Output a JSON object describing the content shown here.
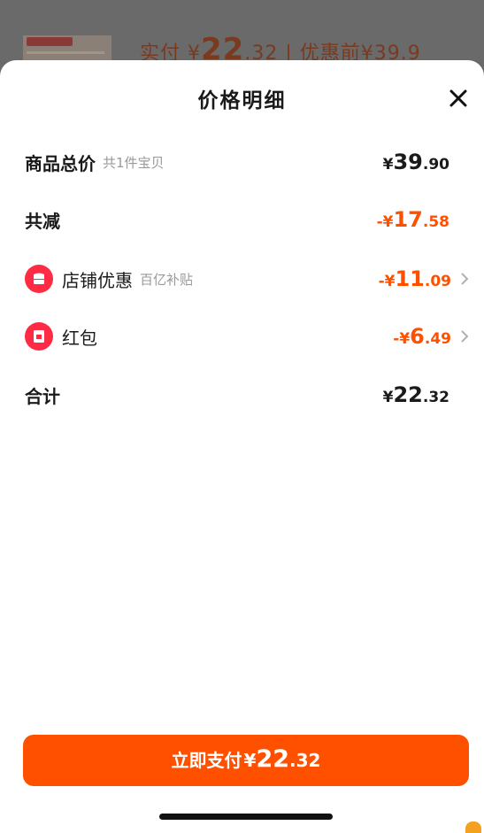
{
  "background": {
    "paid_label": "实付",
    "currency": "¥",
    "price_int": "22",
    "price_dec": ".32",
    "separator": "|",
    "original_label": "优惠前",
    "original_price": "¥39.9"
  },
  "sheet": {
    "title": "价格明细",
    "close_icon": "close-icon"
  },
  "rows": {
    "goods_total": {
      "label": "商品总价",
      "sub": "共1件宝贝",
      "currency": "¥",
      "int": "39",
      "dec": ".90"
    },
    "total_discount": {
      "label": "共减",
      "currency": "-¥",
      "int": "17",
      "dec": ".58"
    },
    "store_discount": {
      "icon": "store-coupon-icon",
      "label": "店铺优惠",
      "sub": "百亿补贴",
      "currency": "-¥",
      "int": "11",
      "dec": ".09"
    },
    "red_packet": {
      "icon": "red-packet-icon",
      "label": "红包",
      "currency": "-¥",
      "int": "6",
      "dec": ".49"
    },
    "total": {
      "label": "合计",
      "currency": "¥",
      "int": "22",
      "dec": ".32"
    }
  },
  "pay_button": {
    "label": "立即支付",
    "currency": "¥",
    "int": "22",
    "dec": ".32"
  },
  "colors": {
    "accent": "#ff5000",
    "coupon_red": "#ff2a43"
  }
}
